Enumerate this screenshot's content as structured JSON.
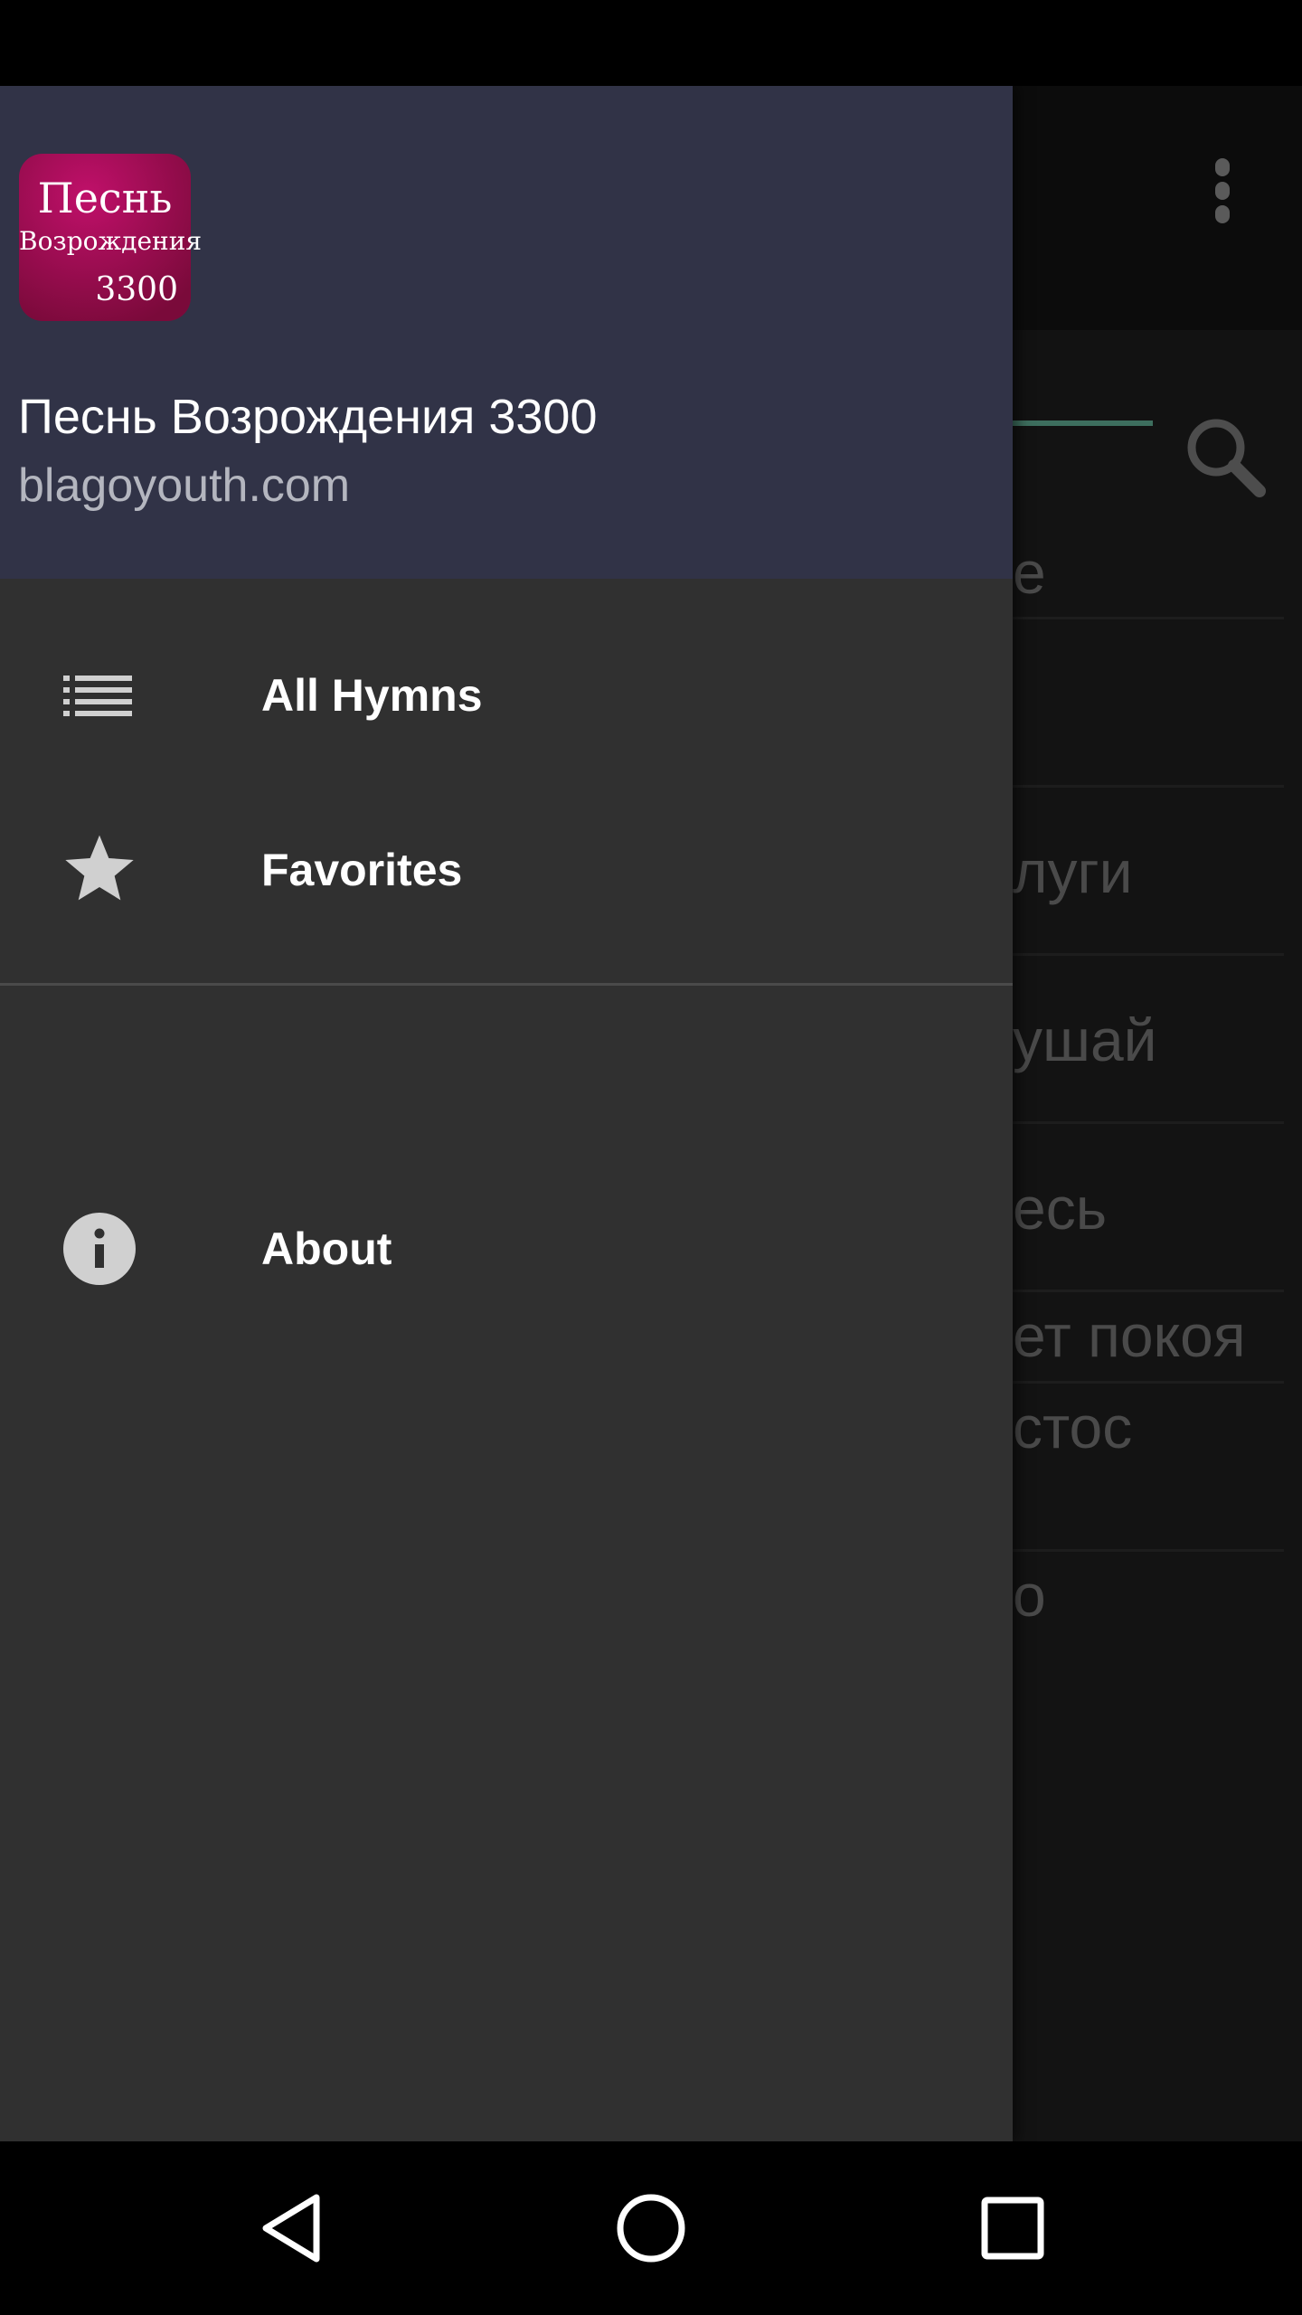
{
  "drawer": {
    "header": {
      "logo_text": [
        "Песнь",
        "Возрождения",
        "3300"
      ],
      "title": "Песнь Возрождения 3300",
      "subtitle": "blagoyouth.com",
      "color": "#313347"
    },
    "items": [
      {
        "label": "All Hymns",
        "icon": "list-icon"
      },
      {
        "label": "Favorites",
        "icon": "star-icon"
      },
      {
        "label": "About",
        "icon": "info-icon"
      }
    ]
  },
  "background_list": {
    "rows": [
      "е",
      "",
      "луги",
      "ушай",
      "есь",
      "ет покоя",
      "стос",
      "о"
    ]
  },
  "colors": {
    "accent": "#3d6e5e",
    "drawer_bg": "#303030"
  }
}
